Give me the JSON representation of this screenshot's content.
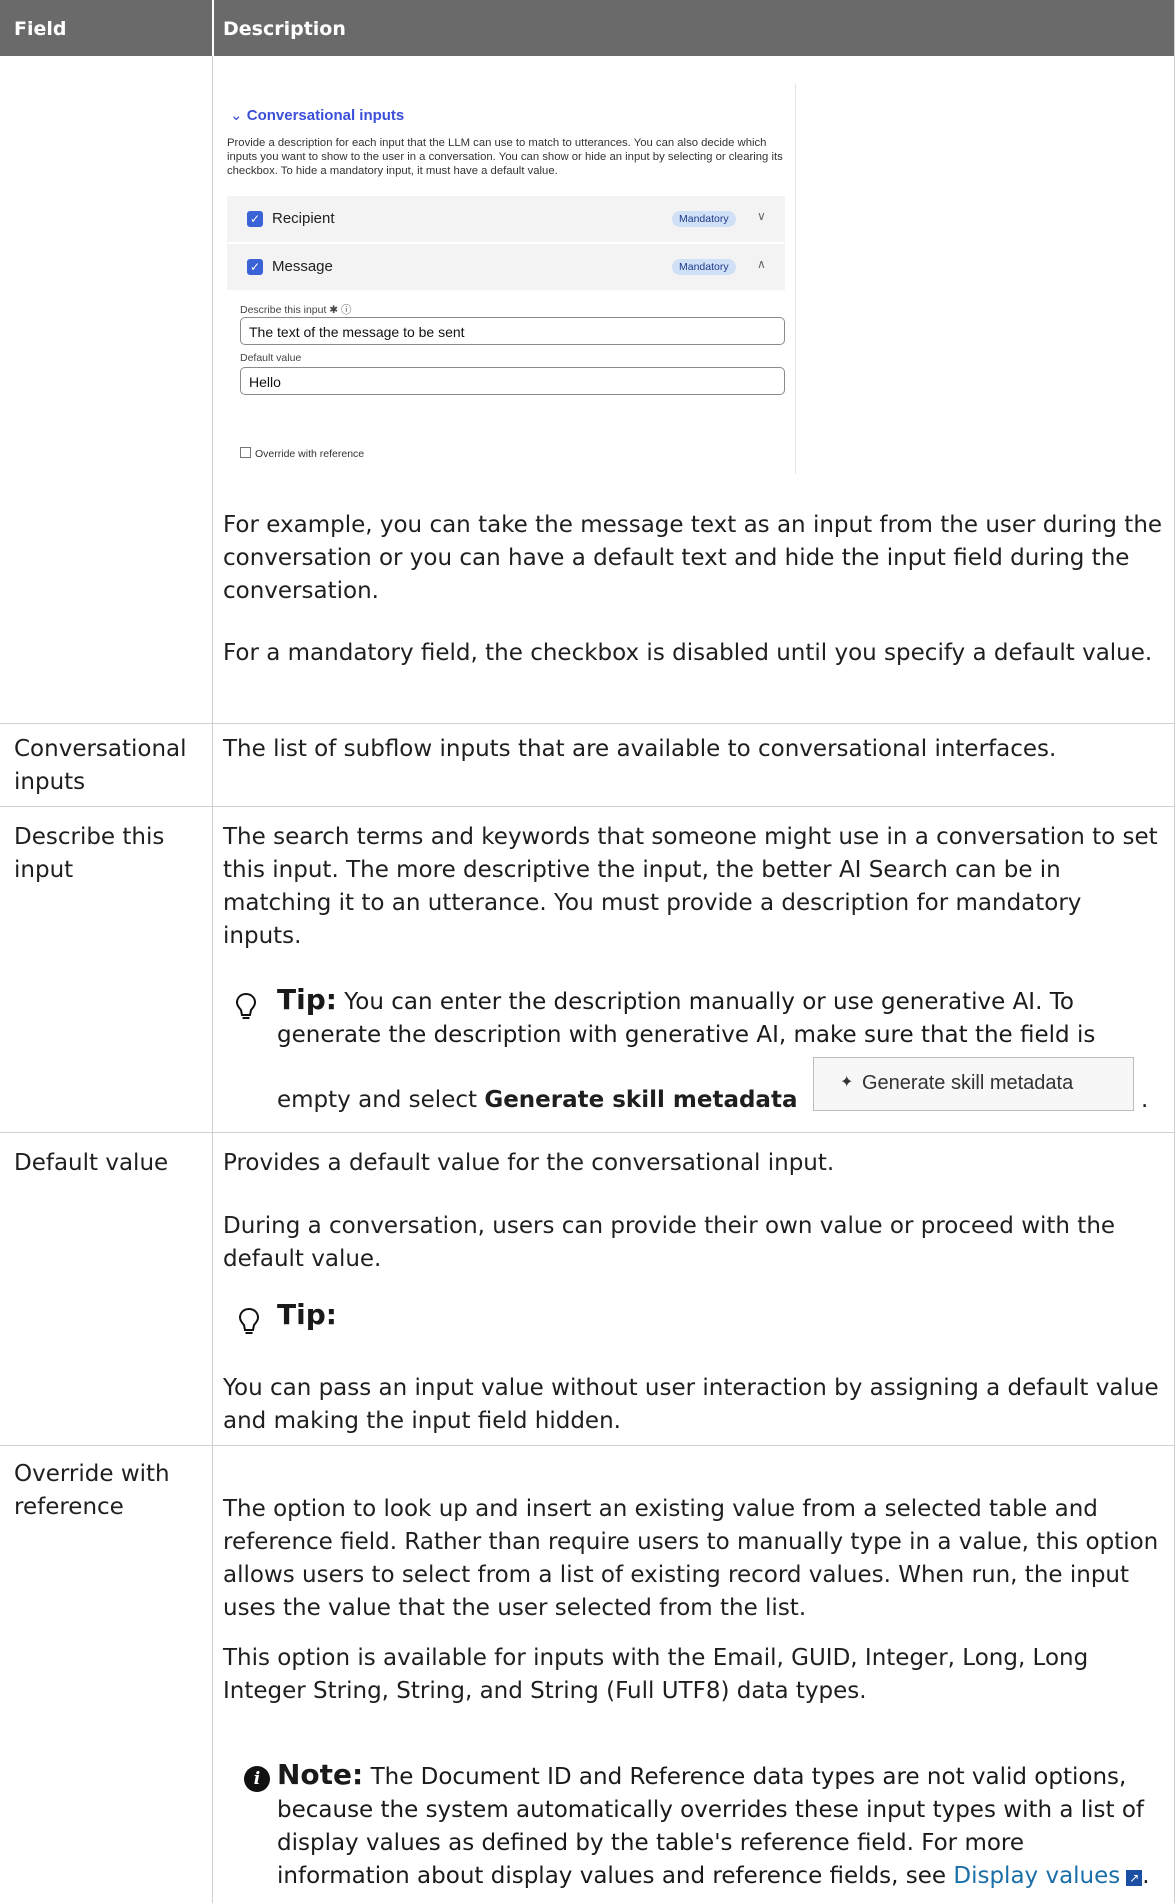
{
  "table": {
    "headers": [
      "Field",
      "Description"
    ]
  },
  "screenshot": {
    "section_title": "Conversational inputs",
    "description": "Provide a description for each input that the LLM can use to match to utterances. You can also decide which inputs you want to show to the user in a conversation. You can show or hide an input by selecting or clearing its checkbox. To hide a mandatory input, it must have a default value.",
    "rows": [
      {
        "label": "Recipient",
        "badge": "Mandatory"
      },
      {
        "label": "Message",
        "badge": "Mandatory"
      }
    ],
    "describe_label": "Describe this input ✱ ⓘ",
    "describe_value": "The text of the message to be sent",
    "default_label": "Default value",
    "default_value": "Hello",
    "override_label": "Override with reference"
  },
  "row0": {
    "p1": "For example, you can take the message text as an input from the user during the conversation or you can have a default text and hide the input field during the conversation.",
    "p2": "For a mandatory field, the checkbox is disabled until you specify a default value."
  },
  "row1": {
    "field": "Conversational inputs",
    "desc": "The list of subflow inputs that are available to conversational interfaces."
  },
  "row2": {
    "field": "Describe this input",
    "desc": "The search terms and keywords that someone might use in a conversation to set this input. The more descriptive the input, the better AI Search can be in matching it to an utterance. You must provide a description for mandatory inputs.",
    "tip_label": "Tip:",
    "tip_text": "You can enter the description manually or use generative AI. To generate the description with generative AI, make sure that the field is",
    "tip_text2": "empty and select",
    "tip_bold": "Generate skill metadata",
    "button_label": "Generate skill metadata",
    "period": "."
  },
  "row3": {
    "field": "Default value",
    "p1": "Provides a default value for the conversational input.",
    "p2": "During a conversation, users can provide their own value or proceed with the default value.",
    "tip_label": "Tip:",
    "p3": "You can pass an input value without user interaction by assigning a default value and making the input field hidden."
  },
  "row4": {
    "field": "Override with reference",
    "p1": "The option to look up and insert an existing value from a selected table and reference field. Rather than require users to manually type in a value, this option allows users to select from a list of existing record values. When run, the input uses the value that the user selected from the list.",
    "p2": "This option is available for inputs with the Email, GUID, Integer, Long, Long Integer String, String, and String (Full UTF8) data types.",
    "note_label": "Note:",
    "note_text": "The Document ID and Reference data types are not valid options, because the system automatically overrides these input types with a list of display values as defined by the table's reference field. For more information about display values and reference fields, see",
    "link_text": "Display values",
    "period": "."
  }
}
